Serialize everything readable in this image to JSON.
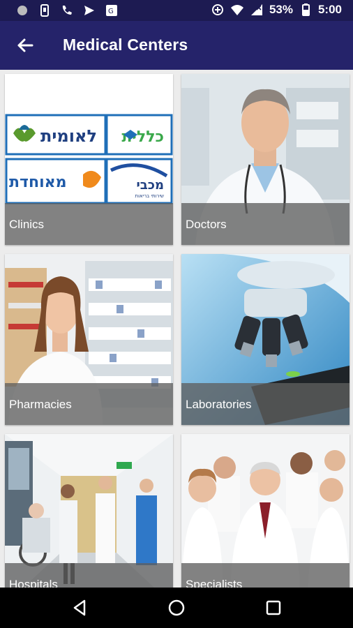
{
  "status_bar": {
    "battery": "53%",
    "time": "5:00"
  },
  "app_bar": {
    "title": "Medical Centers"
  },
  "logos": {
    "clalit": "כללית",
    "leumit": "לאומית",
    "maccabi": "מכבי",
    "meuhedet": "מאוחדת",
    "maccabi_sub": "שירותי בריאות"
  },
  "cards": [
    {
      "label": "Clinics"
    },
    {
      "label": "Doctors"
    },
    {
      "label": "Pharmacies"
    },
    {
      "label": "Laboratories"
    },
    {
      "label": "Hospitals"
    },
    {
      "label": "Specialists"
    }
  ],
  "colors": {
    "status_bar": "#1d1b52",
    "app_bar": "#25236a",
    "caption_overlay": "#5f5f5f",
    "nav_bar": "#000000"
  },
  "icons": {
    "back": "arrow-left-icon",
    "nav": [
      "back-triangle-icon",
      "home-circle-icon",
      "recents-square-icon"
    ]
  }
}
